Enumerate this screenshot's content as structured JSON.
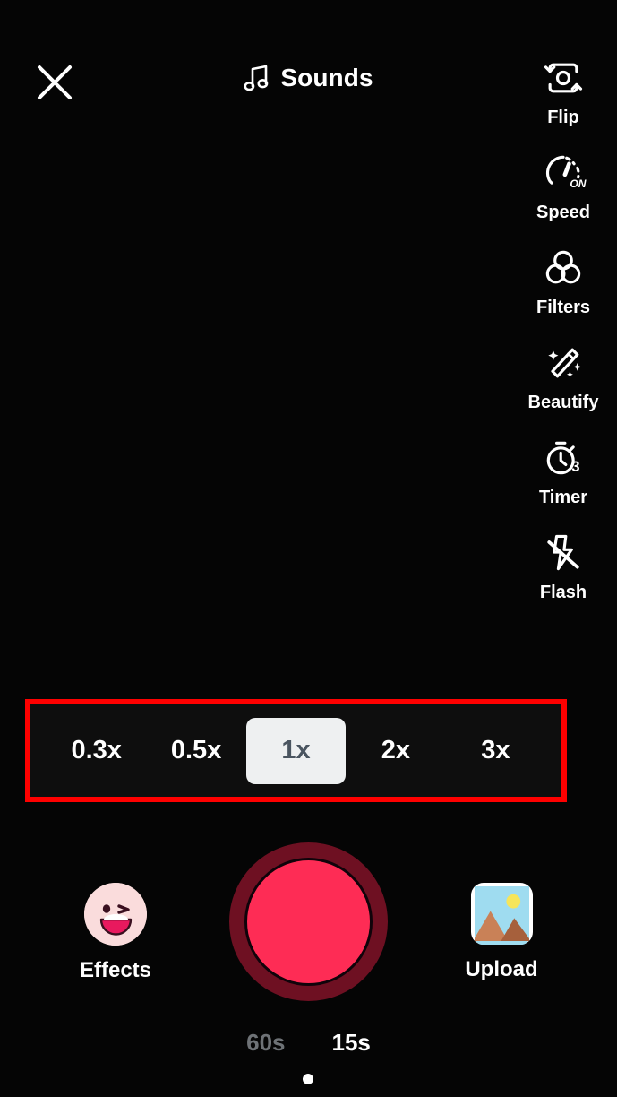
{
  "header": {
    "close_icon": "close-icon",
    "sounds_icon": "music-note-icon",
    "sounds_label": "Sounds"
  },
  "tools": [
    {
      "icon": "camera-flip-icon",
      "label": "Flip"
    },
    {
      "icon": "speedometer-icon",
      "label": "Speed",
      "badge": "ON"
    },
    {
      "icon": "filters-circles-icon",
      "label": "Filters"
    },
    {
      "icon": "magic-wand-icon",
      "label": "Beautify"
    },
    {
      "icon": "stopwatch-icon",
      "label": "Timer",
      "badge": "3"
    },
    {
      "icon": "flash-off-icon",
      "label": "Flash"
    }
  ],
  "speed_selector": {
    "options": [
      {
        "label": "0.3x",
        "selected": false
      },
      {
        "label": "0.5x",
        "selected": false
      },
      {
        "label": "1x",
        "selected": true
      },
      {
        "label": "2x",
        "selected": false
      },
      {
        "label": "3x",
        "selected": false
      }
    ],
    "selected_value": "1x",
    "highlight_color": "#fe0000",
    "selected_pill_color": "#eef0f1",
    "selected_text_color": "#4a5560"
  },
  "capture": {
    "effects_label": "Effects",
    "effects_icon": "winking-face-emoji-icon",
    "record_icon": "record-button",
    "record_color": "#fe2c55",
    "record_ring_color": "#6e1022",
    "upload_label": "Upload",
    "upload_icon": "photo-thumbnail-icon"
  },
  "duration_selector": {
    "options": [
      {
        "label": "60s",
        "selected": false
      },
      {
        "label": "15s",
        "selected": true
      }
    ],
    "selected_value": "15s"
  }
}
